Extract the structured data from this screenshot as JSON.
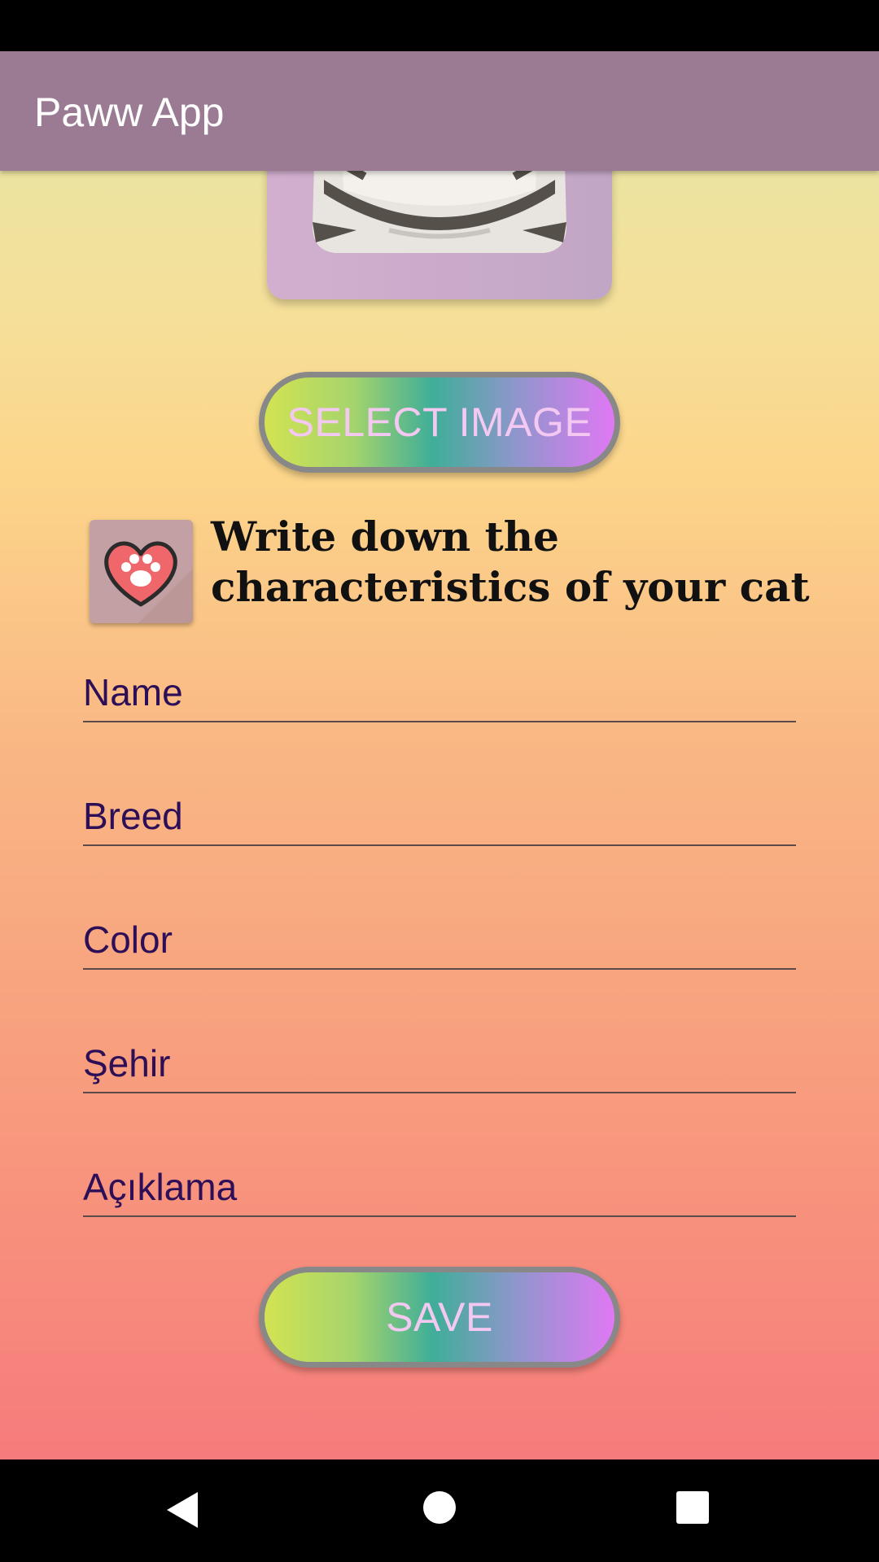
{
  "app_bar": {
    "title": "Paww App"
  },
  "image_panel": {
    "icon": "cat-face-image"
  },
  "select_button": {
    "label": "SELECT IMAGE"
  },
  "section": {
    "icon": "heart-paw-icon",
    "heading_line1": "Write down the",
    "heading_line2": "characteristics of your cat"
  },
  "form": {
    "name_placeholder": "Name",
    "breed_placeholder": "Breed",
    "color_placeholder": "Color",
    "city_placeholder": "Şehir",
    "description_placeholder": "Açıklama"
  },
  "save_button": {
    "label": "SAVE"
  },
  "nav": {
    "back_icon": "back-triangle-icon",
    "home_icon": "home-circle-icon",
    "recents_icon": "recents-square-icon"
  }
}
